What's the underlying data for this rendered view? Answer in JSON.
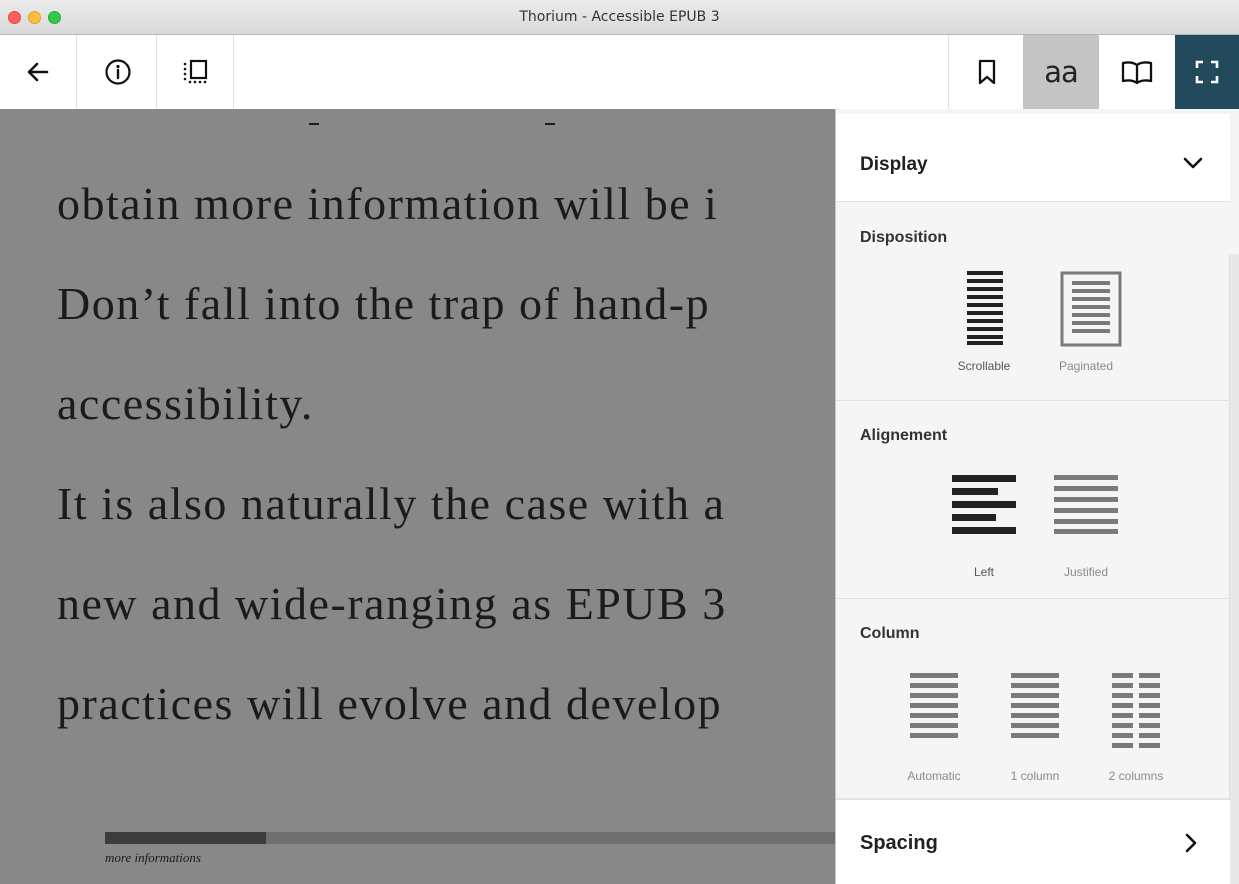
{
  "window": {
    "title": "Thorium - Accessible EPUB 3"
  },
  "toolbar": {
    "left": [
      {
        "icon": "back-arrow-icon"
      },
      {
        "icon": "info-icon"
      },
      {
        "icon": "toc-icon"
      }
    ],
    "right": [
      {
        "icon": "bookmark-icon"
      },
      {
        "icon": "font-settings-icon",
        "text": "aa",
        "active": true
      },
      {
        "icon": "open-book-icon"
      },
      {
        "icon": "fullscreen-icon",
        "active": true
      }
    ]
  },
  "reader": {
    "lines": [
      "obtain more information will be i",
      "Don’t fall into the trap of hand-p",
      "accessibility.",
      "It is also naturally the case with a",
      "new and wide-ranging as EPUB 3",
      "practices will evolve and develop"
    ],
    "progress_fraction": 0.22,
    "footer_label": "more informations"
  },
  "panel": {
    "header": "Display",
    "disposition": {
      "title": "Disposition",
      "options": [
        {
          "label": "Scrollable",
          "selected": true
        },
        {
          "label": "Paginated",
          "selected": false
        }
      ]
    },
    "alignment": {
      "title": "Alignement",
      "options": [
        {
          "label": "Left",
          "selected": true
        },
        {
          "label": "Justified",
          "selected": false
        }
      ]
    },
    "column": {
      "title": "Column",
      "options": [
        {
          "label": "Automatic"
        },
        {
          "label": "1 column"
        },
        {
          "label": "2 columns"
        }
      ]
    },
    "spacing": "Spacing"
  },
  "colors": {
    "reader_bg": "#888888",
    "accent_fullscreen": "#234a5c",
    "active_button": "#c4c4c4"
  }
}
